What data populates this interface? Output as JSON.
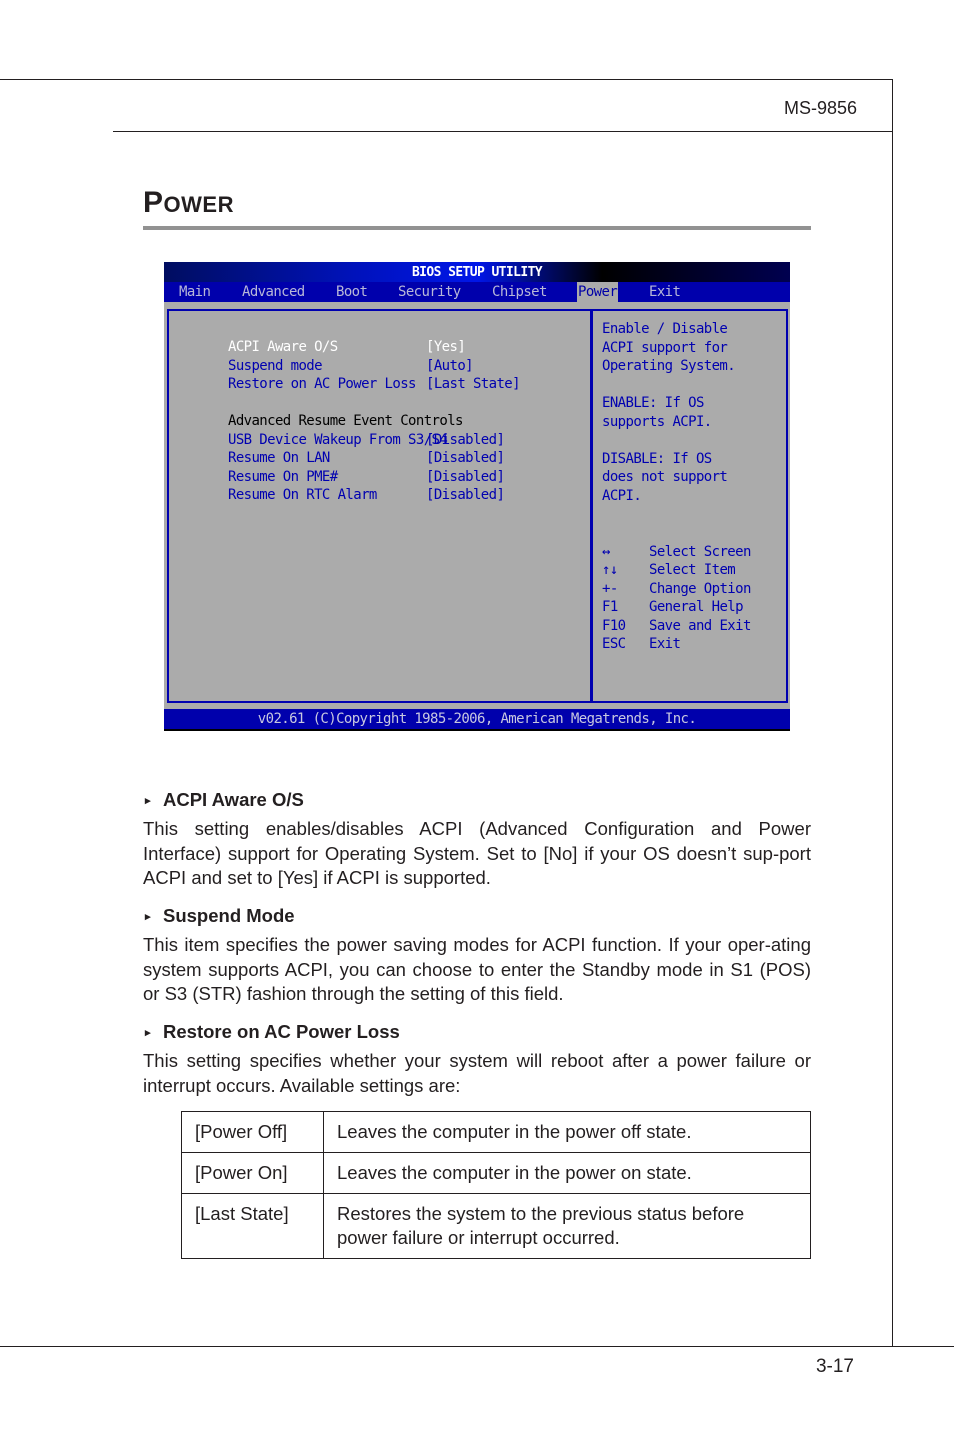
{
  "header": {
    "model": "MS-9856"
  },
  "section": {
    "title_initial": "P",
    "title_rest": "OWER"
  },
  "bios": {
    "title": "BIOS SETUP UTILITY",
    "tabs": [
      {
        "label": "Main"
      },
      {
        "label": "Advanced"
      },
      {
        "label": "Boot"
      },
      {
        "label": "Security"
      },
      {
        "label": "Chipset"
      },
      {
        "label": "Power",
        "active": true
      },
      {
        "label": "Exit"
      }
    ],
    "settings": [
      {
        "label": "ACPI Aware O/S",
        "value": "[Yes]",
        "selected": true
      },
      {
        "label": "Suspend mode",
        "value": "[Auto]"
      },
      {
        "label": "Restore on AC Power Loss",
        "value": "[Last State]"
      },
      {
        "label": "Advanced Resume Event Controls",
        "value": ""
      },
      {
        "label": "USB Device Wakeup From S3/S4",
        "value": "[Disabled]"
      },
      {
        "label": "Resume On LAN",
        "value": "[Disabled]"
      },
      {
        "label": "Resume On PME#",
        "value": "[Disabled]"
      },
      {
        "label": "Resume On RTC Alarm",
        "value": "[Disabled]"
      }
    ],
    "help": [
      "Enable / Disable",
      "ACPI support for",
      "Operating System.",
      "ENABLE: If OS",
      "supports ACPI.",
      "DISABLE: If OS",
      "does not support",
      "ACPI."
    ],
    "keys": [
      {
        "key": "↔",
        "action": "Select Screen"
      },
      {
        "key": "↑↓",
        "action": "Select Item"
      },
      {
        "key": "+-",
        "action": "Change Option"
      },
      {
        "key": "F1",
        "action": "General Help"
      },
      {
        "key": "F10",
        "action": "Save and Exit"
      },
      {
        "key": "ESC",
        "action": "Exit"
      }
    ],
    "footer": "v02.61 (C)Copyright 1985-2006, American Megatrends, Inc."
  },
  "items": [
    {
      "heading": "ACPI Aware O/S",
      "text": "This setting enables/disables ACPI (Advanced Configuration and Power Interface) support for Operating System. Set to [No] if your OS doesn’t sup-port ACPI and set to [Yes] if ACPI is supported."
    },
    {
      "heading": "Suspend Mode",
      "text": "This item specifies the power saving modes for ACPI function. If your oper-ating system supports ACPI, you can choose to enter the Standby mode in S1 (POS) or S3 (STR) fashion through the setting of this field."
    },
    {
      "heading": "Restore on AC Power Loss",
      "text": "This setting specifies whether your system will reboot after a power failure or interrupt occurs. Available settings are:"
    }
  ],
  "bullet_icon": "▸",
  "settings_table": [
    {
      "option": "[Power Off]",
      "description": "Leaves the computer in the power off state."
    },
    {
      "option": "[Power On]",
      "description": "Leaves the computer in the power on state."
    },
    {
      "option": "[Last State]",
      "description": "Restores the system to the previous status before power failure or interrupt occurred."
    }
  ],
  "footer": {
    "page_number": "3-17"
  }
}
